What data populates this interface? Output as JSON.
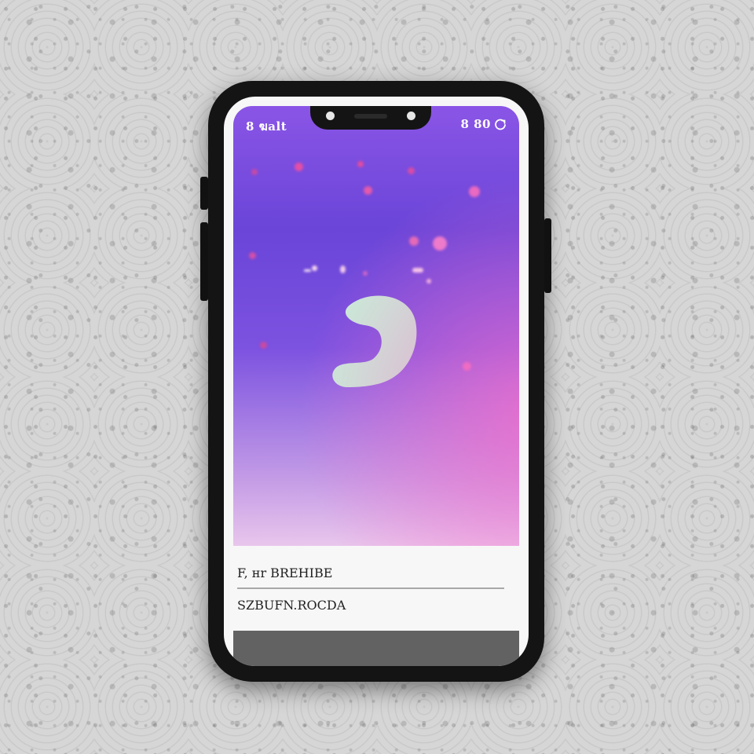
{
  "status_bar": {
    "time": "8 ฆalt",
    "right_text": "8 80",
    "right_icon": "refresh-icon"
  },
  "wallpaper": {
    "gradient_colors": [
      "#8a55e6",
      "#6a45d8",
      "#c49ce6",
      "#e8c6ec",
      "#fa6ec8"
    ],
    "logo_icon": "music-note-icon",
    "logo_color": "#c8efd9"
  },
  "info_panel": {
    "line1": "F, ʜr BREHIBE",
    "line2": "SZBUFN.ROCDA"
  },
  "colors": {
    "phone_frame": "#141414",
    "screen_panel": "#f7f7f7",
    "bottom_bar": "#626262"
  }
}
